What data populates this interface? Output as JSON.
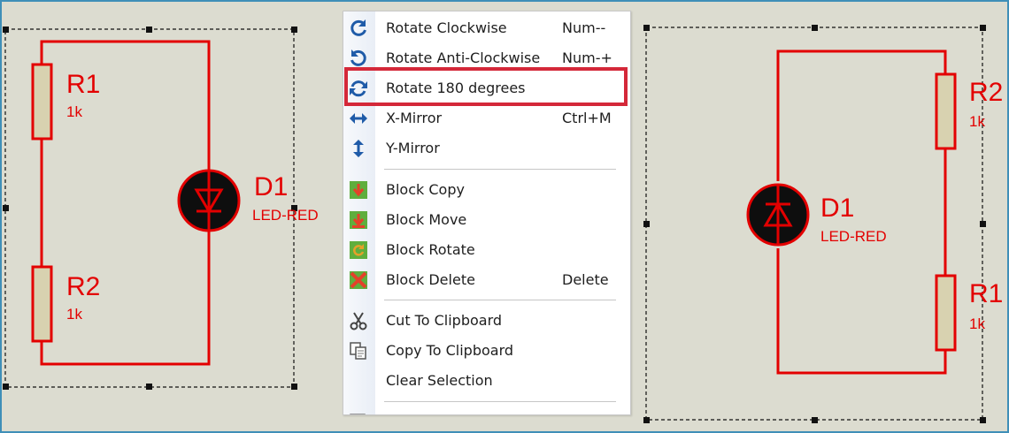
{
  "schematic_left": {
    "resistor_top": {
      "ref": "R1",
      "value": "1k"
    },
    "resistor_bottom": {
      "ref": "R2",
      "value": "1k"
    },
    "led": {
      "ref": "D1",
      "value": "LED-RED"
    }
  },
  "schematic_right": {
    "resistor_top": {
      "ref": "R2",
      "value": "1k"
    },
    "resistor_bottom": {
      "ref": "R1",
      "value": "1k"
    },
    "led": {
      "ref": "D1",
      "value": "LED-RED"
    }
  },
  "context_menu": {
    "items": [
      {
        "label": "Rotate Clockwise",
        "shortcut": "Num--",
        "icon": "rotate-clockwise-icon"
      },
      {
        "label": "Rotate Anti-Clockwise",
        "shortcut": "Num-+",
        "icon": "rotate-anticlockwise-icon"
      },
      {
        "label": "Rotate 180 degrees",
        "shortcut": "",
        "icon": "rotate-180-icon"
      },
      {
        "label": "X-Mirror",
        "shortcut": "Ctrl+M",
        "icon": "x-mirror-icon"
      },
      {
        "label": "Y-Mirror",
        "shortcut": "",
        "icon": "y-mirror-icon"
      },
      {
        "label": "Block Copy",
        "shortcut": "",
        "icon": "block-copy-icon"
      },
      {
        "label": "Block Move",
        "shortcut": "",
        "icon": "block-move-icon"
      },
      {
        "label": "Block Rotate",
        "shortcut": "",
        "icon": "block-rotate-icon"
      },
      {
        "label": "Block Delete",
        "shortcut": "Delete",
        "icon": "block-delete-icon"
      },
      {
        "label": "Cut To Clipboard",
        "shortcut": "",
        "icon": "scissors-icon"
      },
      {
        "label": "Copy To Clipboard",
        "shortcut": "",
        "icon": "copy-icon"
      },
      {
        "label": "Clear Selection",
        "shortcut": "",
        "icon": ""
      }
    ],
    "highlighted_item": "Rotate 180 degrees"
  },
  "colors": {
    "wire": "#e30000",
    "resistor_fill": "#d8d2b0",
    "canvas_background": "#dcdcd0",
    "highlight_box": "#d42839",
    "frame_border": "#3f8fb8"
  }
}
